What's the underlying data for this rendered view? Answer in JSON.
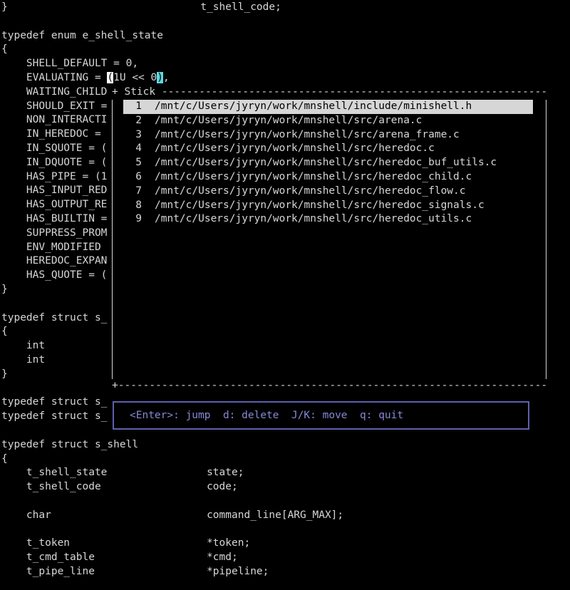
{
  "editor": {
    "lines": [
      {
        "row": 0,
        "text": "}                               t_shell_code;"
      },
      {
        "row": 2,
        "text": "typedef enum e_shell_state"
      },
      {
        "row": 3,
        "text": "{"
      },
      {
        "row": 4,
        "text": "    SHELL_DEFAULT = 0,"
      },
      {
        "row": 6,
        "text": "    WAITING_CHILD"
      },
      {
        "row": 7,
        "text": "    SHOULD_EXIT ="
      },
      {
        "row": 8,
        "text": "    NON_INTERACTI"
      },
      {
        "row": 9,
        "text": "    IN_HEREDOC = "
      },
      {
        "row": 10,
        "text": "    IN_SQUOTE = ("
      },
      {
        "row": 11,
        "text": "    IN_DQUOTE = ("
      },
      {
        "row": 12,
        "text": "    HAS_PIPE = (1"
      },
      {
        "row": 13,
        "text": "    HAS_INPUT_RED"
      },
      {
        "row": 14,
        "text": "    HAS_OUTPUT_RE"
      },
      {
        "row": 15,
        "text": "    HAS_BUILTIN ="
      },
      {
        "row": 16,
        "text": "    SUPPRESS_PROM"
      },
      {
        "row": 17,
        "text": "    ENV_MODIFIED "
      },
      {
        "row": 18,
        "text": "    HEREDOC_EXPAN"
      },
      {
        "row": 19,
        "text": "    HAS_QUOTE = ("
      },
      {
        "row": 20,
        "text": "}"
      },
      {
        "row": 22,
        "text": "typedef struct s_"
      },
      {
        "row": 23,
        "text": "{"
      },
      {
        "row": 24,
        "text": "    int"
      },
      {
        "row": 25,
        "text": "    int"
      },
      {
        "row": 26,
        "text": "}"
      },
      {
        "row": 28,
        "text": "typedef struct s_"
      },
      {
        "row": 29,
        "text": "typedef struct s_"
      },
      {
        "row": 31,
        "text": "typedef struct s_shell"
      },
      {
        "row": 32,
        "text": "{"
      },
      {
        "row": 33,
        "text": "    t_shell_state                state;"
      },
      {
        "row": 34,
        "text": "    t_shell_code                 code;"
      },
      {
        "row": 36,
        "text": "    char                         command_line[ARG_MAX];"
      },
      {
        "row": 38,
        "text": "    t_token                      *token;"
      },
      {
        "row": 39,
        "text": "    t_cmd_table                  *cmd;"
      },
      {
        "row": 40,
        "text": "    t_pipe_line                  *pipeline;"
      }
    ],
    "cursor_line": {
      "prefix": "    EVALUATING = ",
      "cursor_char": "(",
      "middle": "1U << 0",
      "match_char": ")",
      "suffix": ","
    }
  },
  "popup": {
    "title": "Stick",
    "border_top": "+ Stick ------------------------------------------------------------------+",
    "border_bottom": "+------------------------------------------------------------------------+",
    "entries": [
      {
        "num": "1",
        "path": "/mnt/c/Users/jyryn/work/mnshell/include/minishell.h",
        "selected": true
      },
      {
        "num": "2",
        "path": "/mnt/c/Users/jyryn/work/mnshell/src/arena.c"
      },
      {
        "num": "3",
        "path": "/mnt/c/Users/jyryn/work/mnshell/src/arena_frame.c"
      },
      {
        "num": "4",
        "path": "/mnt/c/Users/jyryn/work/mnshell/src/heredoc.c"
      },
      {
        "num": "5",
        "path": "/mnt/c/Users/jyryn/work/mnshell/src/heredoc_buf_utils.c"
      },
      {
        "num": "6",
        "path": "/mnt/c/Users/jyryn/work/mnshell/src/heredoc_child.c"
      },
      {
        "num": "7",
        "path": "/mnt/c/Users/jyryn/work/mnshell/src/heredoc_flow.c"
      },
      {
        "num": "8",
        "path": "/mnt/c/Users/jyryn/work/mnshell/src/heredoc_signals.c"
      },
      {
        "num": "9",
        "path": "/mnt/c/Users/jyryn/work/mnshell/src/heredoc_utils.c"
      }
    ]
  },
  "help": {
    "text": "<Enter>: jump  d: delete  J/K: move  q: quit"
  },
  "colors": {
    "background": "#000000",
    "foreground": "#d6d6d6",
    "match_highlight": "#5fd7df",
    "help_border": "#5f5faf",
    "help_text": "#8787d7"
  }
}
